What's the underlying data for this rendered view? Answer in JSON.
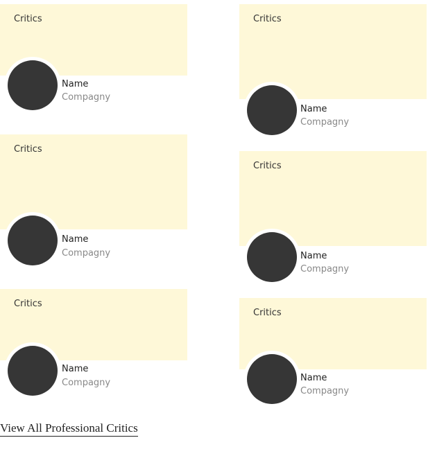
{
  "cards": [
    {
      "label": "Critics",
      "name": "Name",
      "company": "Compagny"
    },
    {
      "label": "Critics",
      "name": "Name",
      "company": "Compagny"
    },
    {
      "label": "Critics",
      "name": "Name",
      "company": "Compagny"
    },
    {
      "label": "Critics",
      "name": "Name",
      "company": "Compagny"
    },
    {
      "label": "Critics",
      "name": "Name",
      "company": "Compagny"
    },
    {
      "label": "Critics",
      "name": "Name",
      "company": "Compagny"
    }
  ],
  "footer": {
    "view_all_label": "View All Professional Critics"
  }
}
